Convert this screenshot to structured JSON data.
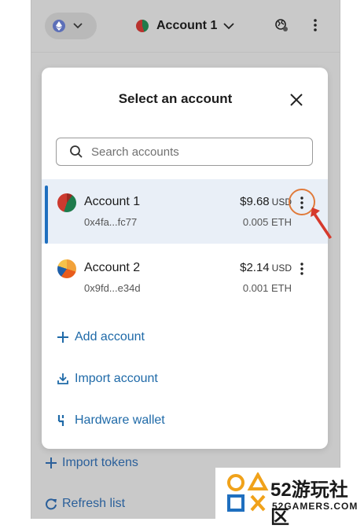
{
  "header": {
    "account_title": "Account 1"
  },
  "modal": {
    "title": "Select an account",
    "search": {
      "placeholder": "Search accounts",
      "value": ""
    },
    "accounts": [
      {
        "name": "Account 1",
        "address": "0x4fa...fc77",
        "fiat": "$9.68",
        "currency": "USD",
        "eth": "0.005 ETH",
        "selected": true
      },
      {
        "name": "Account 2",
        "address": "0x9fd...e34d",
        "fiat": "$2.14",
        "currency": "USD",
        "eth": "0.001 ETH",
        "selected": false
      }
    ],
    "actions": {
      "add_account": "Add account",
      "import_account": "Import account",
      "hardware_wallet": "Hardware wallet"
    }
  },
  "background_links": {
    "import_tokens": "Import tokens",
    "refresh_list": "Refresh list"
  },
  "colors": {
    "accent": "#1f6aa8",
    "selected_bar": "#1f6fbf",
    "selected_row_bg": "#e9eff7",
    "annotation": "#e07a3a"
  },
  "watermark": {
    "brand": "52游玩社区",
    "domain": "52GAMERS.COM"
  }
}
